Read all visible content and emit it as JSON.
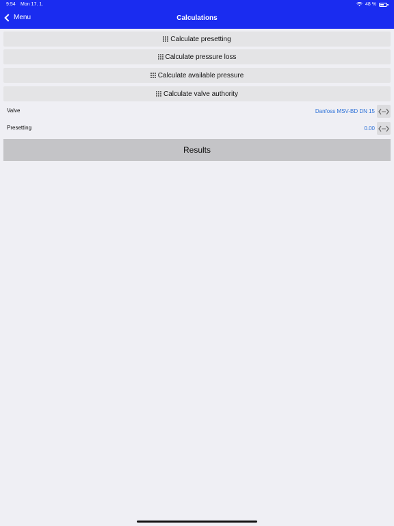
{
  "status": {
    "time": "9:54",
    "date": "Mon 17. 1.",
    "battery": "48 %"
  },
  "nav": {
    "back_label": "Menu",
    "title": "Calculations"
  },
  "buttons": [
    {
      "label": "Calculate presetting"
    },
    {
      "label": "Calculate pressure loss"
    },
    {
      "label": "Calculate available pressure"
    },
    {
      "label": "Calculate valve authority"
    }
  ],
  "fields": [
    {
      "label": "Valve",
      "value": "Danfoss MSV-BD DN 15"
    },
    {
      "label": "Presetting",
      "value": "0.00"
    }
  ],
  "results_label": "Results",
  "colors": {
    "nav_bar": "#1a2cf0",
    "value_text": "#2e72d8",
    "background": "#efeff4"
  }
}
